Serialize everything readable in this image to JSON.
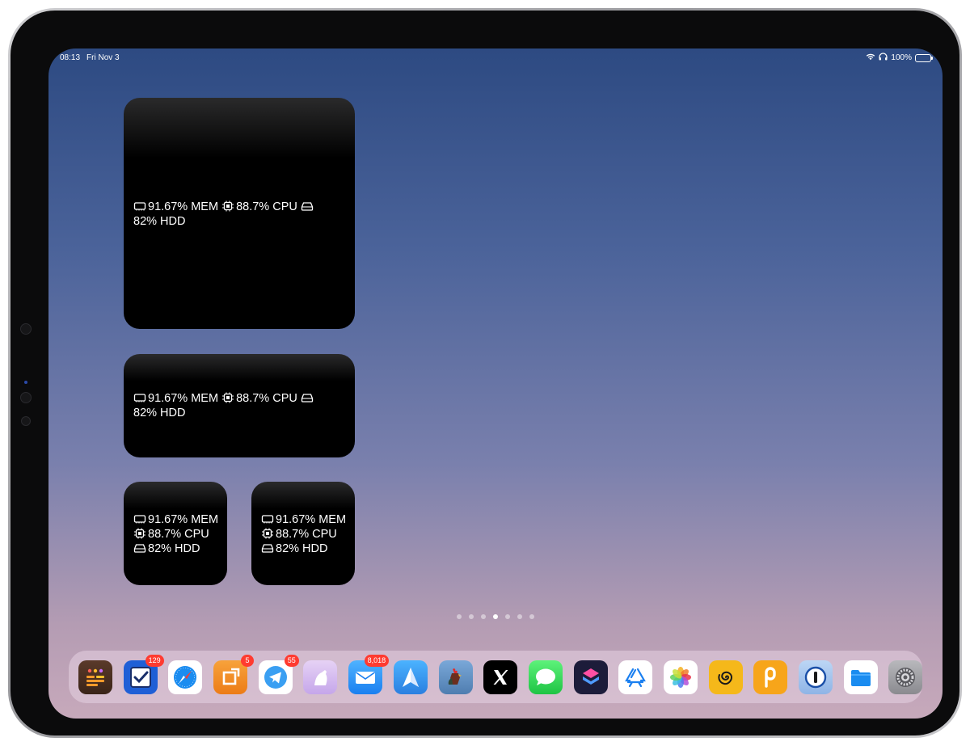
{
  "status_bar": {
    "time": "08:13",
    "date": "Fri Nov 3",
    "battery_percent": "100%",
    "battery_level": 1.0,
    "icons": [
      "wifi-icon",
      "headphones-icon",
      "battery-charging-icon"
    ]
  },
  "widgets": {
    "large": {
      "mem": "91.67% MEM",
      "cpu": "88.7% CPU",
      "hdd": "82% HDD"
    },
    "medium": {
      "mem": "91.67% MEM",
      "cpu": "88.7% CPU",
      "hdd": "82% HDD"
    },
    "small_1": {
      "mem": "91.67% MEM",
      "cpu": "88.7% CPU",
      "hdd": "82% HDD"
    },
    "small_2": {
      "mem": "91.67% MEM",
      "cpu": "88.7% CPU",
      "hdd": "82% HDD"
    },
    "icons": [
      "memory-icon",
      "cpu-icon",
      "disk-icon"
    ]
  },
  "page_dots": {
    "count": 7,
    "active_index": 3
  },
  "dock": {
    "apps": [
      {
        "name": "app-window-manager",
        "badge": ""
      },
      {
        "name": "app-tasks",
        "badge": "129"
      },
      {
        "name": "app-safari",
        "badge": ""
      },
      {
        "name": "app-crop",
        "badge": "5"
      },
      {
        "name": "app-telegram",
        "badge": "55"
      },
      {
        "name": "app-bear",
        "badge": ""
      },
      {
        "name": "app-mail",
        "badge": "8,018"
      },
      {
        "name": "app-spark",
        "badge": ""
      },
      {
        "name": "app-rooster",
        "badge": ""
      },
      {
        "name": "app-x",
        "badge": ""
      },
      {
        "name": "app-messages",
        "badge": ""
      },
      {
        "name": "app-shortcuts",
        "badge": ""
      },
      {
        "name": "app-app-store",
        "badge": ""
      },
      {
        "name": "app-photos",
        "badge": ""
      },
      {
        "name": "app-spiral",
        "badge": ""
      },
      {
        "name": "app-pockity",
        "badge": ""
      },
      {
        "name": "app-1password",
        "badge": ""
      },
      {
        "name": "app-files",
        "badge": ""
      },
      {
        "name": "app-settings",
        "badge": ""
      }
    ]
  },
  "colors": {
    "badge": "#ff3b30",
    "battery": "#32d74b",
    "widget_bg": "#000000",
    "wallpaper_top": "#2d4a82",
    "wallpaper_bottom": "#c7a9bb"
  }
}
